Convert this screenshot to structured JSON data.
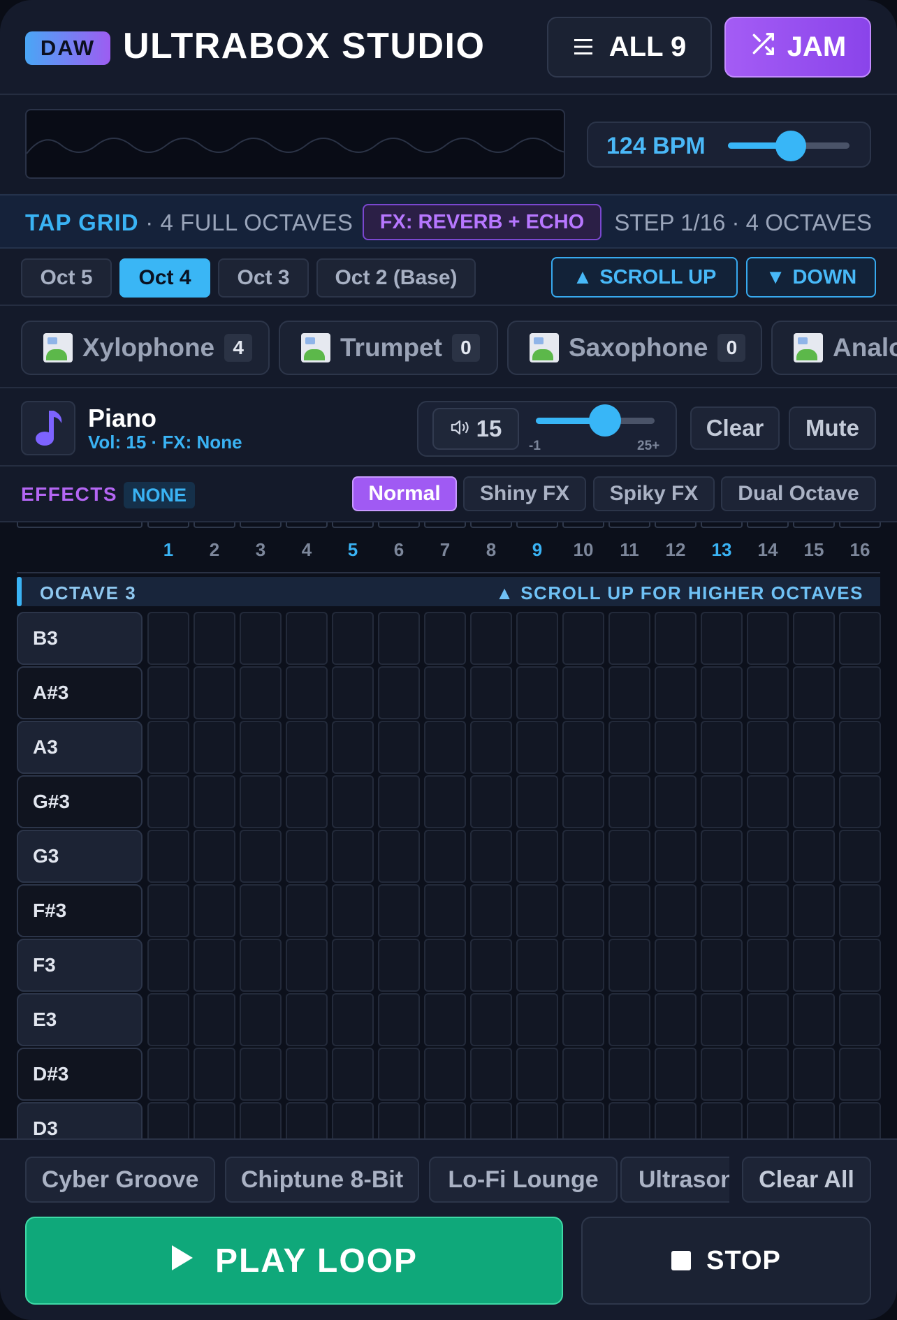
{
  "header": {
    "badge": "DAW",
    "title": "ULTRABOX STUDIO",
    "all_label": "ALL 9",
    "jam_label": "JAM",
    "menu_icon": "menu-icon",
    "shuffle_icon": "shuffle-icon"
  },
  "tempo": {
    "bpm_label": "124 BPM",
    "bpm_level": 0.52
  },
  "info": {
    "tap_grid": "TAP GRID",
    "tap_sub": " · 4 FULL OCTAVES",
    "fx_chip": "FX: REVERB + ECHO",
    "step_text": "STEP 1/16 · 4 OCTAVES"
  },
  "octaves": {
    "tabs": [
      {
        "label": "Oct 5",
        "active": false
      },
      {
        "label": "Oct 4",
        "active": true
      },
      {
        "label": "Oct 3",
        "active": false
      },
      {
        "label": "Oct 2 (Base)",
        "active": false
      }
    ],
    "scroll_up": "SCROLL UP",
    "scroll_down": "DOWN"
  },
  "instruments": [
    {
      "name": "Xylophone",
      "count": "4"
    },
    {
      "name": "Trumpet",
      "count": "0"
    },
    {
      "name": "Saxophone",
      "count": "0"
    },
    {
      "name": "Analo",
      "count": ""
    }
  ],
  "track": {
    "name": "Piano",
    "subtitle": "Vol: 15 · FX: None",
    "note_icon": "music-note-icon",
    "volume_value": "15",
    "volume_level": 0.58,
    "slider_min": "-1",
    "slider_max": "25+",
    "clear_label": "Clear",
    "mute_label": "Mute",
    "speaker_icon": "speaker-icon"
  },
  "effects": {
    "label": "EFFECTS",
    "current": "NONE",
    "options": [
      {
        "label": "Normal",
        "active": true
      },
      {
        "label": "Shiny FX",
        "active": false
      },
      {
        "label": "Spiky FX",
        "active": false
      },
      {
        "label": "Dual Octave",
        "active": false
      }
    ]
  },
  "grid": {
    "steps": [
      "1",
      "2",
      "3",
      "4",
      "5",
      "6",
      "7",
      "8",
      "9",
      "10",
      "11",
      "12",
      "13",
      "14",
      "15",
      "16"
    ],
    "accent_steps": [
      "1",
      "5",
      "9",
      "13"
    ],
    "octave_title": "OCTAVE 3",
    "octave_hint": "▲ SCROLL UP FOR HIGHER OCTAVES",
    "notes": [
      "B3",
      "A#3",
      "A3",
      "G#3",
      "G3",
      "F#3",
      "F3",
      "E3",
      "D#3",
      "D3"
    ]
  },
  "presets": {
    "items": [
      "Cyber Groove",
      "Chiptune 8-Bit",
      "Lo-Fi Lounge",
      "Ultrasonic"
    ],
    "clear_all": "Clear All"
  },
  "transport": {
    "play_label": "PLAY LOOP",
    "stop_label": "STOP"
  },
  "colors": {
    "accent_blue": "#3ab3f4",
    "accent_purple": "#a05af3",
    "play_green": "#0fa87a",
    "background": "#141a2a"
  }
}
